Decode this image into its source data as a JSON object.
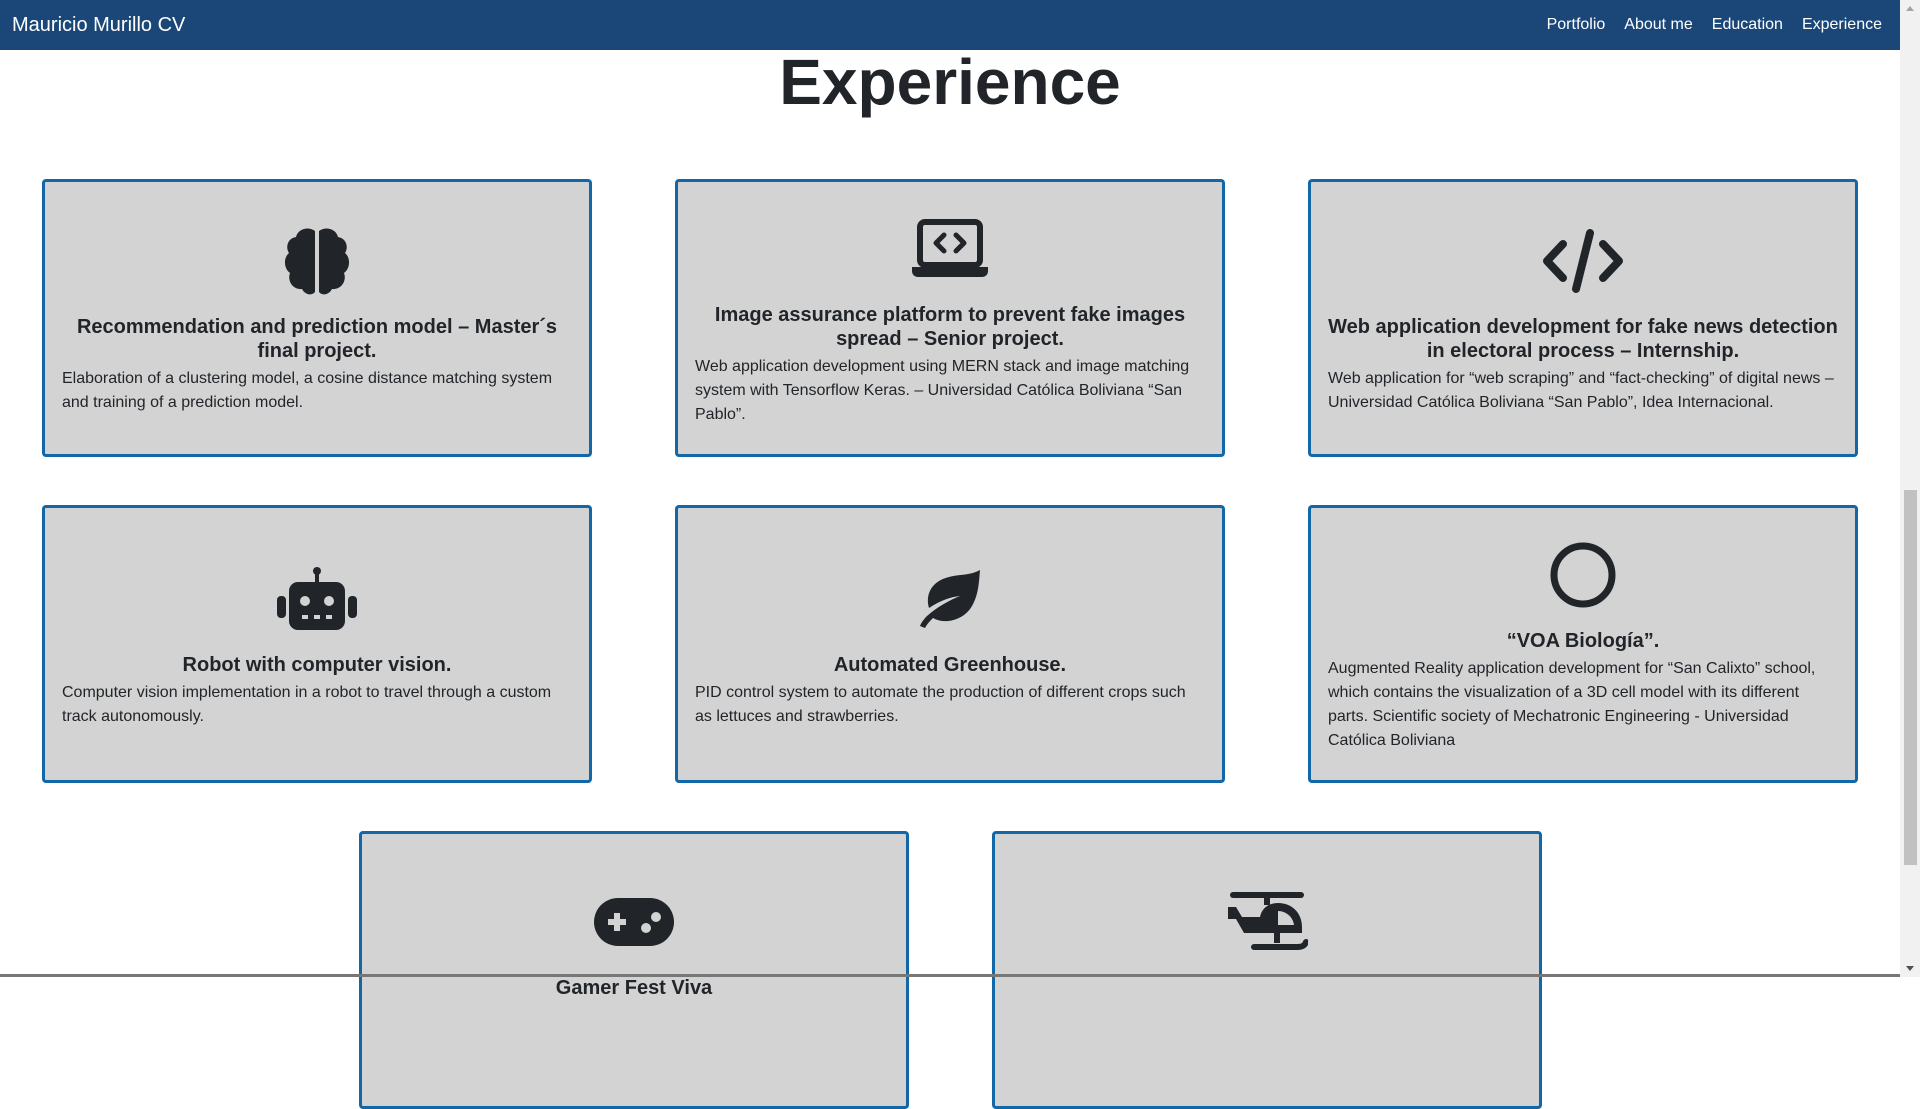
{
  "nav": {
    "brand": "Mauricio Murillo CV",
    "links": [
      "Portfolio",
      "About me",
      "Education",
      "Experience"
    ]
  },
  "section": {
    "title": "Experience"
  },
  "cards": [
    {
      "icon": "brain-icon",
      "title": "Recommendation and prediction model – Master´s final project.",
      "text": "Elaboration of a clustering model, a cosine distance matching system and training of a prediction model."
    },
    {
      "icon": "laptop-code-icon",
      "title": "Image assurance platform to prevent fake images spread – Senior project.",
      "text": "Web application development using MERN stack and image matching system with Tensorflow Keras. – Universidad Católica Boliviana “San Pablo”."
    },
    {
      "icon": "code-icon",
      "title": "Web application development for fake news detection in electoral process – Internship.",
      "text": "Web application for “web scraping” and “fact-checking” of digital news – Universidad Católica Boliviana “San Pablo”, Idea Internacional."
    },
    {
      "icon": "robot-icon",
      "title": "Robot with computer vision.",
      "text": "Computer vision implementation in a robot to travel through a custom track autonomously."
    },
    {
      "icon": "leaf-icon",
      "title": "Automated Greenhouse.",
      "text": "PID control system to automate the production of different crops such as lettuces and strawberries."
    },
    {
      "icon": "circle-icon",
      "title": "“VOA Biología”.",
      "text": "Augmented Reality application development for “San Calixto” school, which contains the visualization of a 3D cell model with its different parts. Scientific society of Mechatronic Engineering - Universidad Católica Boliviana"
    },
    {
      "icon": "gamepad-icon",
      "title": "Gamer Fest Viva",
      "text": ""
    },
    {
      "icon": "helicopter-icon",
      "title": "",
      "text": ""
    }
  ],
  "colors": {
    "navbar": "#1a4778",
    "card_border": "#1167a8",
    "card_background": "#d3d3d3",
    "text": "#212529"
  }
}
